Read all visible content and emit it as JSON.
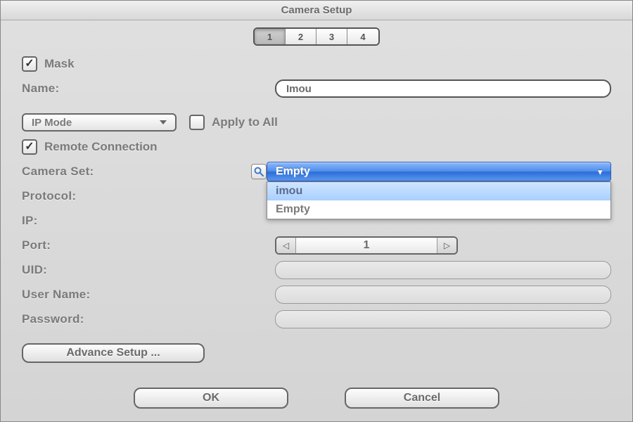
{
  "title": "Camera Setup",
  "tabs": {
    "items": [
      "1",
      "2",
      "3",
      "4"
    ],
    "active": 0
  },
  "mask": {
    "label": "Mask",
    "checked": true
  },
  "name": {
    "label": "Name:",
    "value": "Imou"
  },
  "ip_mode": {
    "selected": "IP Mode"
  },
  "apply_all": {
    "label": "Apply to All",
    "checked": false
  },
  "remote_conn": {
    "label": "Remote Connection",
    "checked": true
  },
  "camera_set": {
    "label": "Camera Set:",
    "selected": "Empty",
    "options": [
      "imou",
      "Empty"
    ],
    "highlighted": 0
  },
  "protocol": {
    "label": "Protocol:"
  },
  "ip": {
    "label": "IP:"
  },
  "port": {
    "label": "Port:",
    "value": "1"
  },
  "uid": {
    "label": "UID:",
    "value": ""
  },
  "user": {
    "label": "User Name:",
    "value": ""
  },
  "pass": {
    "label": "Password:",
    "value": ""
  },
  "advance": {
    "label": "Advance Setup ..."
  },
  "ok": {
    "label": "OK"
  },
  "cancel": {
    "label": "Cancel"
  }
}
